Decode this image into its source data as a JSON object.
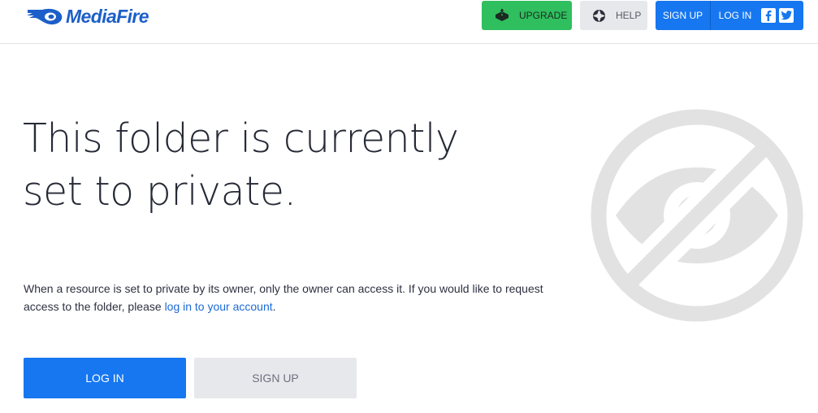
{
  "header": {
    "logo_text": "MediaFire",
    "upgrade_label": "UPGRADE",
    "help_label": "HELP",
    "signup_label": "SIGN UP",
    "login_label": "LOG IN",
    "social": [
      "facebook-icon",
      "twitter-icon"
    ]
  },
  "main": {
    "headline_line1": "This folder is currently",
    "headline_line2": "set to private.",
    "description_before_link": "When a resource is set to private by its owner, only the owner can access it. If you would like to request access to the folder, please ",
    "description_link": "log in to your account",
    "description_after_link": ".",
    "login_button": "LOG IN",
    "signup_button": "SIGN UP"
  },
  "icons": {
    "upgrade": "upgrade-icon",
    "help": "lifebuoy-icon",
    "private": "private-eye-icon"
  },
  "colors": {
    "brand": "#1c5fc8",
    "primary_button": "#1677f0",
    "upgrade_button": "#2fbf5e",
    "secondary_button": "#e7e8eb",
    "link": "#1c6ad4",
    "graphic": "#e2e2e2"
  }
}
